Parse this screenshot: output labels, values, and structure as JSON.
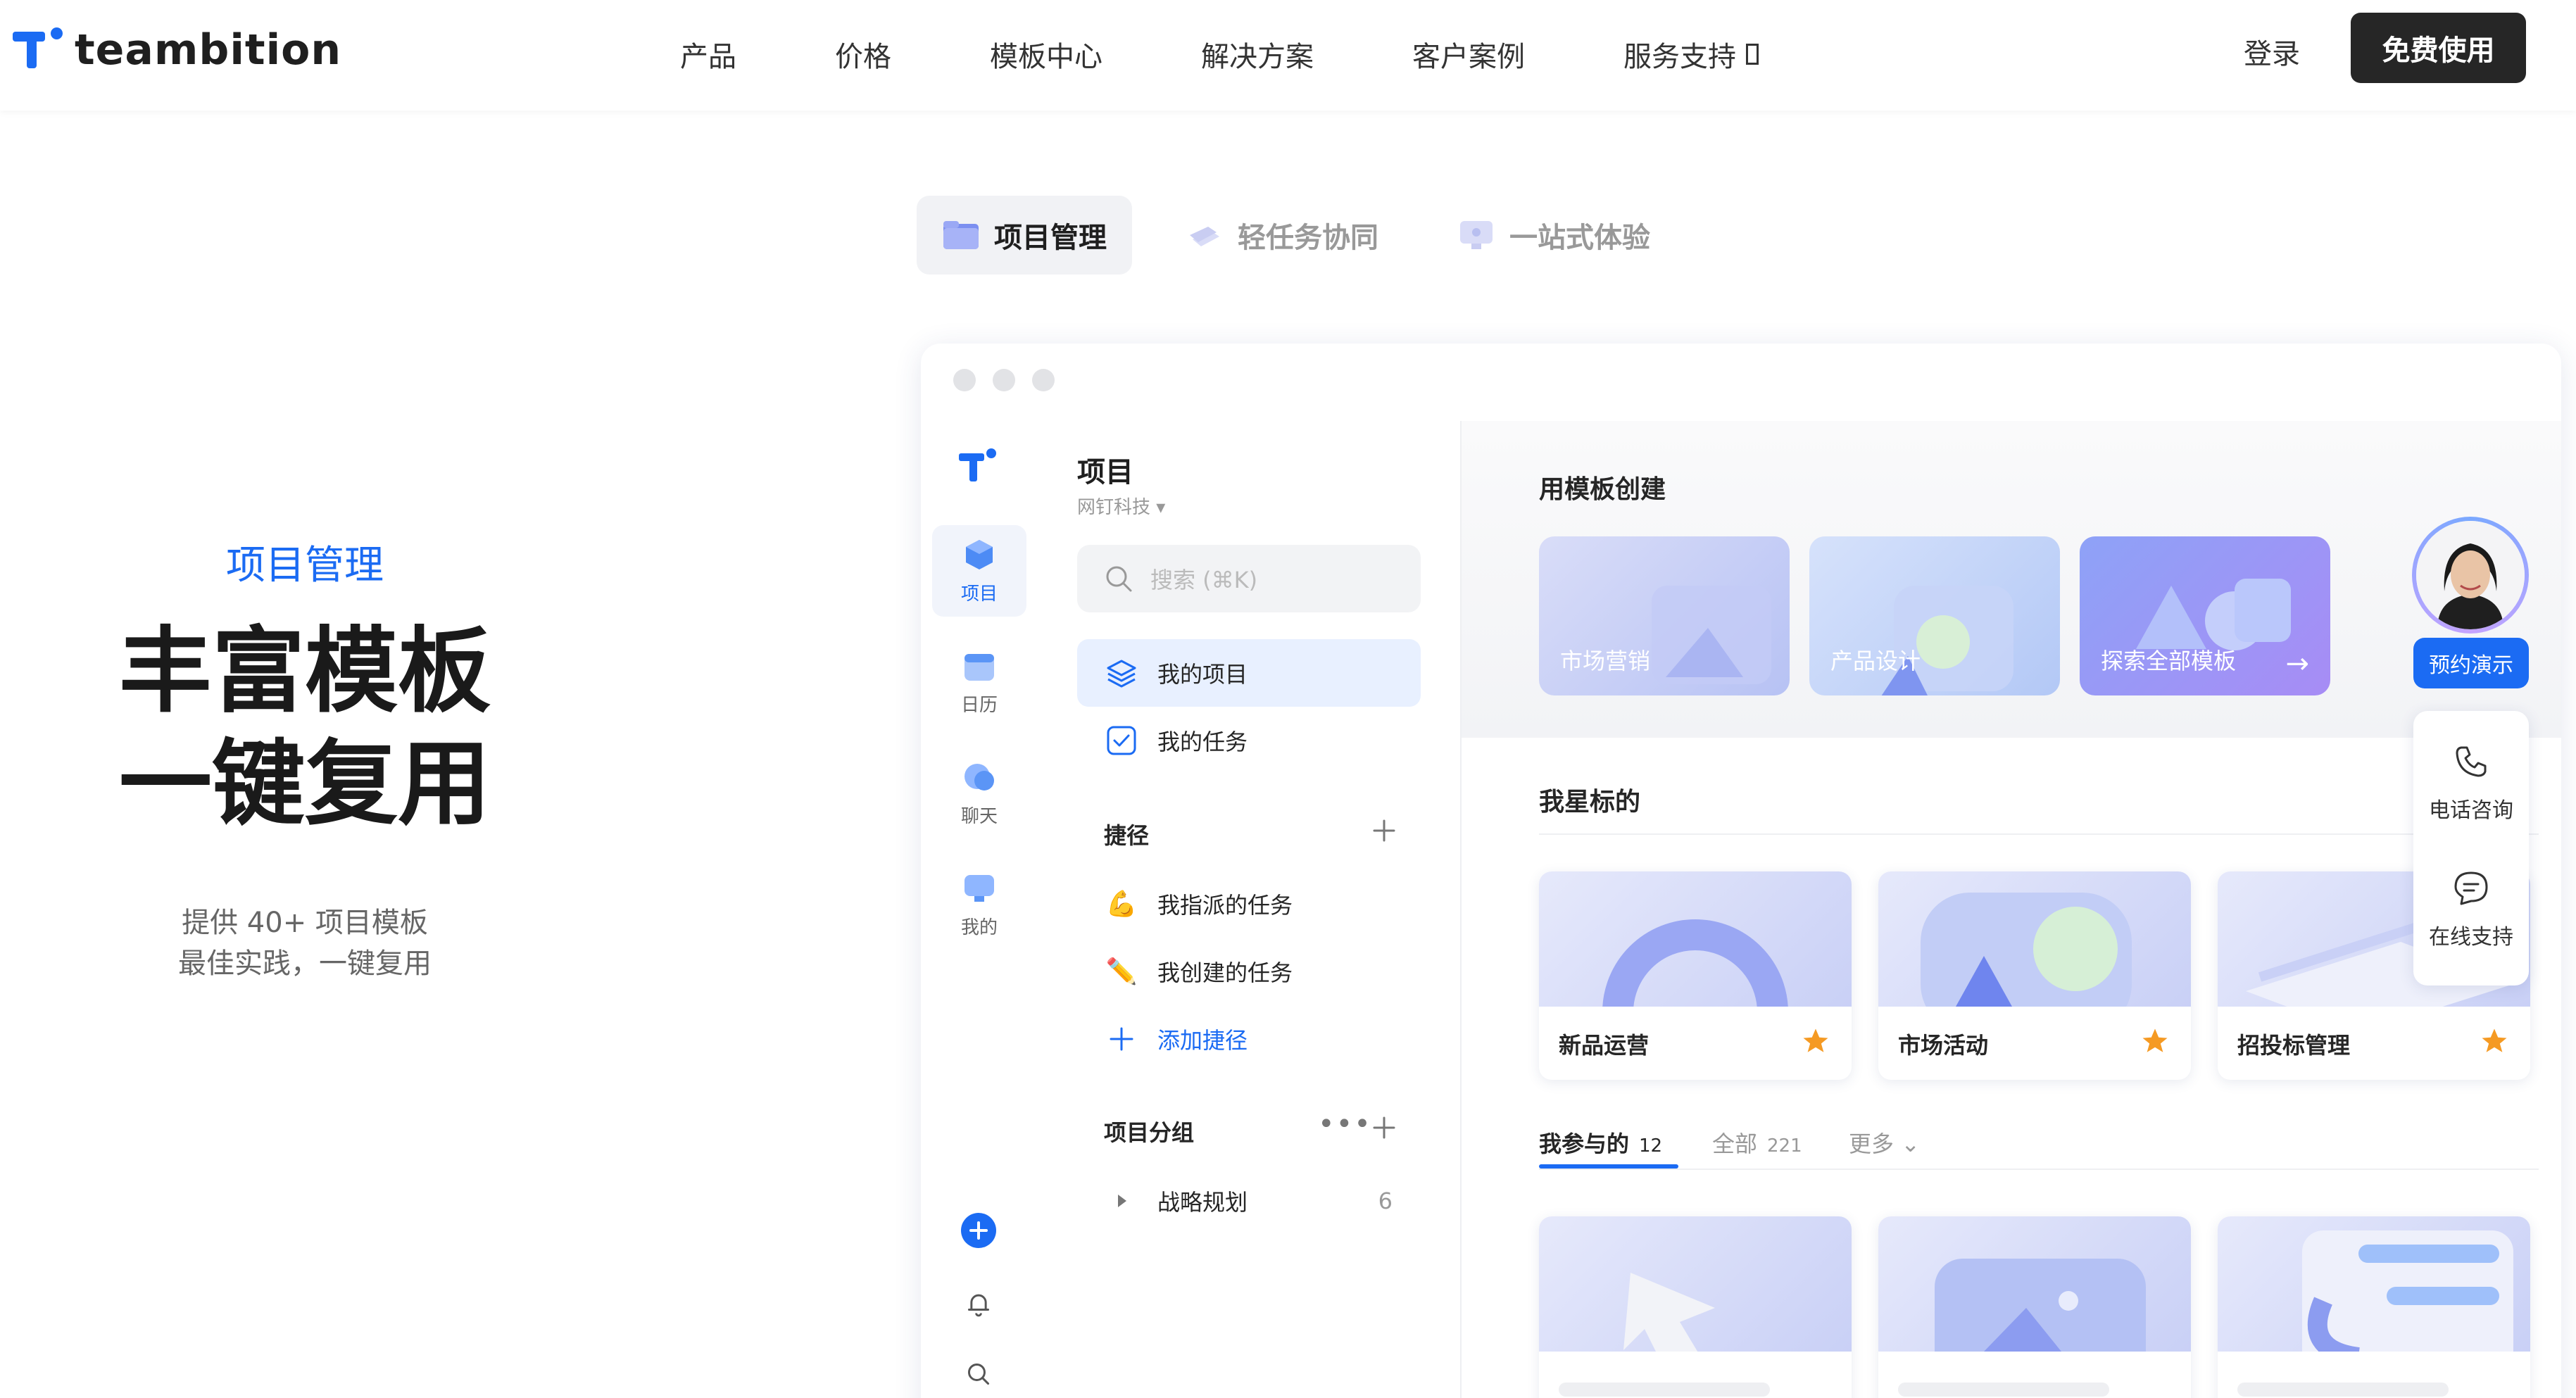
{
  "brand": {
    "name": "teambition",
    "color": "#1b6bf3"
  },
  "nav": {
    "items": [
      "产品",
      "价格",
      "模板中心",
      "解决方案",
      "客户案例",
      "服务支持"
    ],
    "login": "登录",
    "cta": "免费使用"
  },
  "tabs": [
    {
      "label": "项目管理",
      "active": true
    },
    {
      "label": "轻任务协同",
      "active": false
    },
    {
      "label": "一站式体验",
      "active": false
    }
  ],
  "hero": {
    "subtitle": "项目管理",
    "title_line1": "丰富模板",
    "title_line2": "一键复用",
    "desc_line1": "提供 40+ 项目模板",
    "desc_line2": "最佳实践，一键复用"
  },
  "app": {
    "rail": [
      {
        "label": "项目",
        "icon": "cube-icon",
        "active": true
      },
      {
        "label": "日历",
        "icon": "calendar-icon",
        "active": false
      },
      {
        "label": "聊天",
        "icon": "chat-icon",
        "active": false
      },
      {
        "label": "我的",
        "icon": "monitor-icon",
        "active": false
      }
    ],
    "pane": {
      "title": "项目",
      "org": "网钉科技",
      "search_placeholder": "搜索 (⌘K)",
      "my_projects": "我的项目",
      "my_tasks": "我的任务",
      "shortcuts_title": "捷径",
      "shortcut_assigned": "我指派的任务",
      "shortcut_created": "我创建的任务",
      "add_shortcut": "添加捷径",
      "groups_title": "项目分组",
      "group_name": "战略规划",
      "group_count": "6"
    },
    "main": {
      "template_title": "用模板创建",
      "templates": [
        "市场营销",
        "产品设计",
        "探索全部模板"
      ],
      "starred_title": "我星标的",
      "starred": [
        "新品运营",
        "市场活动",
        "招投标管理"
      ],
      "subtabs": {
        "joined": "我参与的",
        "joined_count": "12",
        "all": "全部",
        "all_count": "221",
        "more": "更多"
      }
    }
  },
  "support": {
    "demo": "预约演示",
    "phone": "电话咨询",
    "online": "在线支持"
  }
}
